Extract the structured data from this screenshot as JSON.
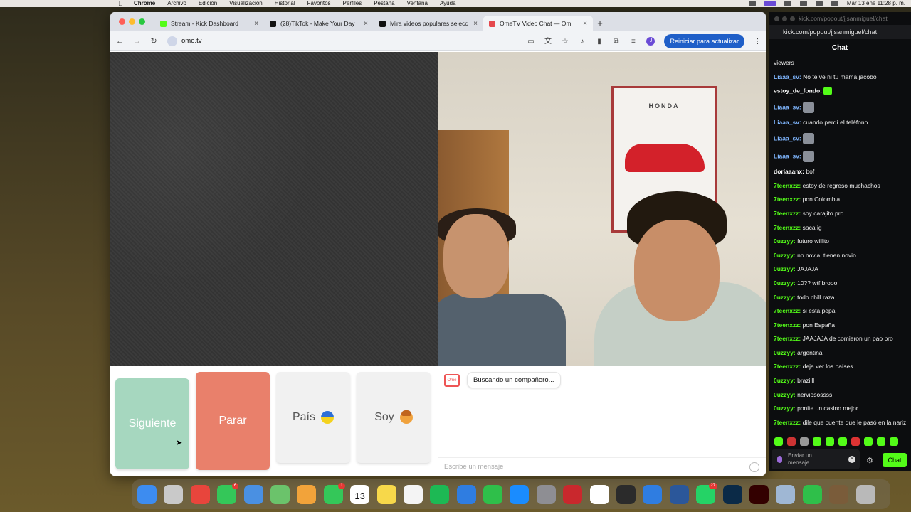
{
  "menubar": {
    "app": "Chrome",
    "items": [
      "Archivo",
      "Edición",
      "Visualización",
      "Historial",
      "Favoritos",
      "Perfiles",
      "Pestaña",
      "Ventana",
      "Ayuda"
    ],
    "clock": "Mar 13 ene  11:28 p. m."
  },
  "browser": {
    "tabs": [
      {
        "label": "Stream - Kick Dashboard",
        "color": "#53fc18",
        "active": false
      },
      {
        "label": "(28)TikTok - Make Your Day",
        "color": "#111111",
        "active": false
      },
      {
        "label": "Mira videos populares selecc",
        "color": "#111111",
        "active": false
      },
      {
        "label": "OmeTV Video Chat — Om",
        "color": "#e5484d",
        "active": true
      }
    ],
    "url": "ome.tv",
    "update_button": "Reiniciar para actualizar",
    "profile_initial": "J"
  },
  "ometv": {
    "poster_brand": "HONDA",
    "buttons": {
      "next": "Siguiente",
      "stop": "Parar",
      "country": "País",
      "soy": "Soy"
    },
    "status_message": "Buscando un compañero...",
    "logo_text": "Ome",
    "input_placeholder": "Escribe un mensaje"
  },
  "kick": {
    "window_url": "kick.com/popout/jjsanmiguel/chat",
    "address": "kick.com/popout/jjsanmiguel/chat",
    "header": "Chat",
    "messages": [
      {
        "user": "",
        "text": "viewers",
        "color": "#eeeeee"
      },
      {
        "user": "Liaaa_sv:",
        "text": "No te ve ni tu mamá jacobo",
        "color": "#7fb6ff"
      },
      {
        "user": "estoy_de_fondo:",
        "text": "",
        "emote": true,
        "color": "#ffffff"
      },
      {
        "user": "Liaaa_sv:",
        "text": "",
        "emote_pic": true,
        "color": "#7fb6ff"
      },
      {
        "user": "Liaaa_sv:",
        "text": "cuando perdí el teléfono",
        "color": "#7fb6ff"
      },
      {
        "user": "Liaaa_sv:",
        "text": "",
        "emote_pic": true,
        "color": "#7fb6ff"
      },
      {
        "user": "Liaaa_sv:",
        "text": "",
        "emote_pic": true,
        "color": "#7fb6ff"
      },
      {
        "user": "doriaaanx:",
        "text": "bof",
        "color": "#ffffff"
      },
      {
        "user": "7teenxzz:",
        "text": "estoy de regreso muchachos",
        "color": "#53fc18"
      },
      {
        "user": "7teenxzz:",
        "text": "pon Colombia",
        "color": "#53fc18"
      },
      {
        "user": "7teenxzz:",
        "text": "soy carajito pro",
        "color": "#53fc18"
      },
      {
        "user": "7teenxzz:",
        "text": "saca ig",
        "color": "#53fc18"
      },
      {
        "user": "0uzzyy:",
        "text": "futuro willito",
        "color": "#53fc18"
      },
      {
        "user": "0uzzyy:",
        "text": "no novia, tienen novio",
        "color": "#53fc18"
      },
      {
        "user": "0uzzyy:",
        "text": "JAJAJA",
        "color": "#53fc18"
      },
      {
        "user": "0uzzyy:",
        "text": "10?? wtf brooo",
        "color": "#53fc18"
      },
      {
        "user": "0uzzyy:",
        "text": "todo chill raza",
        "color": "#53fc18"
      },
      {
        "user": "7teenxzz:",
        "text": "si está pepa",
        "color": "#53fc18"
      },
      {
        "user": "7teenxzz:",
        "text": "pon España",
        "color": "#53fc18"
      },
      {
        "user": "7teenxzz:",
        "text": "JAAJAJA de comieron un pao bro",
        "color": "#53fc18"
      },
      {
        "user": "0uzzyy:",
        "text": "argentina",
        "color": "#53fc18"
      },
      {
        "user": "7teenxzz:",
        "text": "deja ver los países",
        "color": "#53fc18"
      },
      {
        "user": "0uzzyy:",
        "text": "brazilll",
        "color": "#53fc18"
      },
      {
        "user": "0uzzyy:",
        "text": "nerviosossss",
        "color": "#53fc18"
      },
      {
        "user": "0uzzyy:",
        "text": "ponite un casino mejor",
        "color": "#53fc18"
      },
      {
        "user": "7teenxzz:",
        "text": "dile que cuente que le pasó en la nariz",
        "color": "#53fc18"
      }
    ],
    "input_placeholder": "Enviar un mensaje",
    "send_button": "Chat"
  },
  "dock": {
    "icons": [
      {
        "name": "finder-icon",
        "color": "#3d8cf0"
      },
      {
        "name": "launchpad-icon",
        "color": "#c9c9c9"
      },
      {
        "name": "chrome-icon",
        "color": "#e8453c"
      },
      {
        "name": "messages-icon",
        "color": "#34c759",
        "badge": "6"
      },
      {
        "name": "mail-icon",
        "color": "#4a90e2"
      },
      {
        "name": "maps-icon",
        "color": "#6bc36b"
      },
      {
        "name": "photos-icon",
        "color": "#f2a33a"
      },
      {
        "name": "facetime-icon",
        "color": "#34c759",
        "badge": "1"
      },
      {
        "name": "calendar-icon",
        "color": "#ffffff",
        "text": "13"
      },
      {
        "name": "notes-icon",
        "color": "#f7d84a"
      },
      {
        "name": "freeform-icon",
        "color": "#f4f4f4"
      },
      {
        "name": "spotify-icon",
        "color": "#1db954"
      },
      {
        "name": "keynote-icon",
        "color": "#2f7de1"
      },
      {
        "name": "numbers-icon",
        "color": "#2fbf4a"
      },
      {
        "name": "app-store-icon",
        "color": "#1a8cff"
      },
      {
        "name": "system-settings-icon",
        "color": "#8e8e93"
      },
      {
        "name": "app-red-icon",
        "color": "#c9282d"
      },
      {
        "name": "app-feather-icon",
        "color": "#ffffff"
      },
      {
        "name": "obs-icon",
        "color": "#2b2b2b"
      },
      {
        "name": "app-blue-icon",
        "color": "#2f7de1"
      },
      {
        "name": "word-icon",
        "color": "#2b579a"
      },
      {
        "name": "whatsapp-icon",
        "color": "#25d366",
        "badge": "27"
      },
      {
        "name": "photoshop-icon",
        "color": "#0b2a47"
      },
      {
        "name": "illustrator-icon",
        "color": "#330000"
      },
      {
        "name": "preview-icon",
        "color": "#9fb7d4"
      },
      {
        "name": "app-green-icon",
        "color": "#2fbf4a"
      },
      {
        "name": "folder-icon",
        "color": "#7a5c3a"
      },
      {
        "name": "trash-icon",
        "color": "#b9b9b9"
      }
    ]
  }
}
